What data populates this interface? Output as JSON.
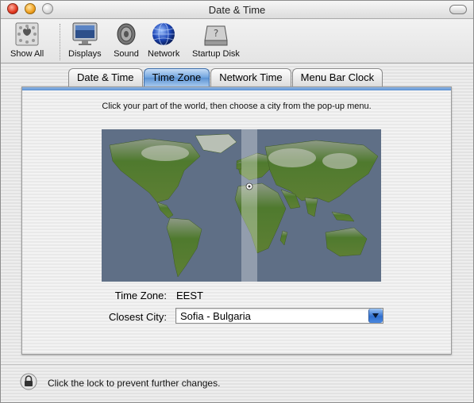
{
  "window": {
    "title": "Date & Time"
  },
  "toolbar": {
    "items": [
      {
        "label": "Show All",
        "icon": "apple-grid-icon"
      },
      {
        "label": "Displays",
        "icon": "monitor-icon"
      },
      {
        "label": "Sound",
        "icon": "speaker-icon"
      },
      {
        "label": "Network",
        "icon": "globe-icon"
      },
      {
        "label": "Startup Disk",
        "icon": "hard-disk-icon"
      }
    ]
  },
  "tabs": [
    {
      "label": "Date & Time",
      "active": false
    },
    {
      "label": "Time Zone",
      "active": true
    },
    {
      "label": "Network Time",
      "active": false
    },
    {
      "label": "Menu Bar Clock",
      "active": false
    }
  ],
  "panel": {
    "instruction": "Click your part of the world, then choose a city from the pop-up menu.",
    "time_zone_label": "Time Zone:",
    "time_zone_value": "EEST",
    "closest_city_label": "Closest City:",
    "closest_city_value": "Sofia - Bulgaria"
  },
  "footer": {
    "lock_text": "Click the lock to prevent further changes."
  },
  "colors": {
    "active_tab": "#6ea3de",
    "map_ocean": "#5f6f86",
    "map_land": "#4f7a2e"
  }
}
